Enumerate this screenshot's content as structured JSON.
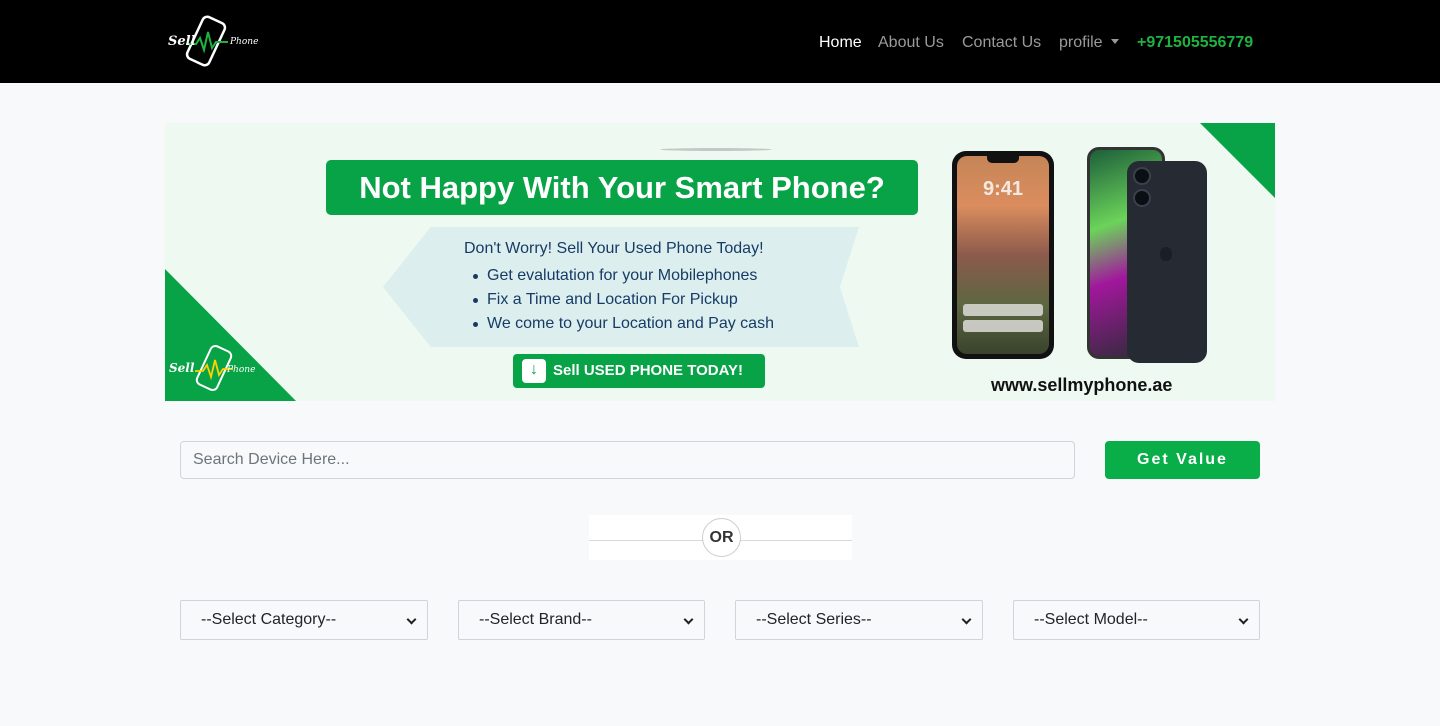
{
  "nav": {
    "logo_text_1": "Sell",
    "logo_text_2": "Phone",
    "home": "Home",
    "about": "About Us",
    "contact": "Contact Us",
    "profile": "profile",
    "phone": "+971505556779"
  },
  "banner": {
    "headline": "Not Happy With Your Smart Phone?",
    "subtitle": "Don't Worry! Sell Your Used Phone Today!",
    "bullets": [
      "Get evalutation for your Mobilephones",
      "Fix a Time and Location For Pickup",
      "We come to your Location and Pay cash"
    ],
    "button": "Sell USED PHONE TODAY!",
    "url": "www.sellmyphone.ae",
    "phone_time": "9:41",
    "logo_text_1": "Sell",
    "logo_text_2": "Phone"
  },
  "search": {
    "placeholder": "Search Device Here...",
    "value": "",
    "button": "Get Value"
  },
  "divider": {
    "label": "OR"
  },
  "filters": {
    "category": "--Select Category--",
    "brand": "--Select Brand--",
    "series": "--Select Series--",
    "model": "--Select Model--"
  },
  "colors": {
    "brand_green": "#08a346",
    "phone_green": "#1eb33f",
    "navbar_bg": "#000000"
  }
}
